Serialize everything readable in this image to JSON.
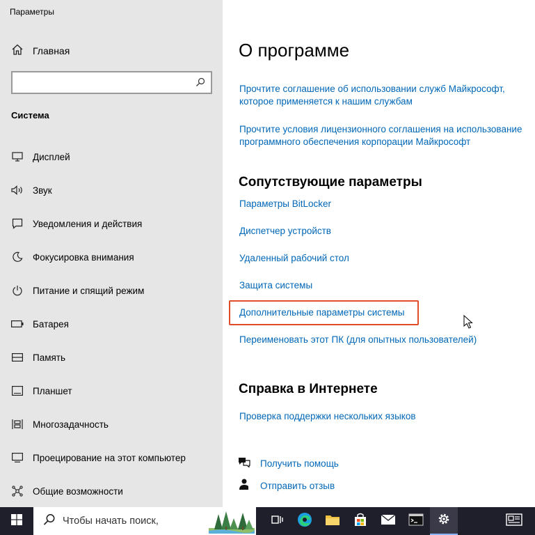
{
  "window": {
    "title": "Параметры"
  },
  "sidebar": {
    "home_label": "Главная",
    "search_placeholder": "",
    "section_title": "Система",
    "items": [
      {
        "label": "Дисплей",
        "icon": "display-icon"
      },
      {
        "label": "Звук",
        "icon": "sound-icon"
      },
      {
        "label": "Уведомления и действия",
        "icon": "notifications-icon"
      },
      {
        "label": "Фокусировка внимания",
        "icon": "focus-assist-icon"
      },
      {
        "label": "Питание и спящий режим",
        "icon": "power-icon"
      },
      {
        "label": "Батарея",
        "icon": "battery-icon"
      },
      {
        "label": "Память",
        "icon": "storage-icon"
      },
      {
        "label": "Планшет",
        "icon": "tablet-icon"
      },
      {
        "label": "Многозадачность",
        "icon": "multitasking-icon"
      },
      {
        "label": "Проецирование на этот компьютер",
        "icon": "projecting-icon"
      },
      {
        "label": "Общие возможности",
        "icon": "shared-experiences-icon"
      }
    ]
  },
  "main": {
    "title": "О программе",
    "top_links": [
      "Прочтите соглашение об использовании служб Майкрософт,",
      "которое применяется к нашим службам",
      "Прочтите условия лицензионного соглашения на использование",
      "программного обеспечения корпорации Майкрософт"
    ],
    "related_title": "Сопутствующие параметры",
    "related_links": [
      "Параметры BitLocker",
      "Диспетчер устройств",
      "Удаленный рабочий стол",
      "Защита системы",
      "Дополнительные параметры системы",
      "Переименовать этот ПК (для опытных пользователей)"
    ],
    "web_help_title": "Справка в Интернете",
    "web_help_links": [
      "Проверка поддержки нескольких языков"
    ],
    "get_help": "Получить помощь",
    "feedback": "Отправить отзыв",
    "accent_color": "#0067b8",
    "highlight_color": "#e04b2a"
  },
  "taskbar": {
    "search_text": "Чтобы начать поиск,",
    "icons": [
      "windows-start-icon",
      "task-view-icon",
      "edge-icon",
      "file-explorer-icon",
      "store-icon",
      "mail-icon",
      "terminal-icon",
      "settings-icon",
      "news-icon"
    ]
  }
}
